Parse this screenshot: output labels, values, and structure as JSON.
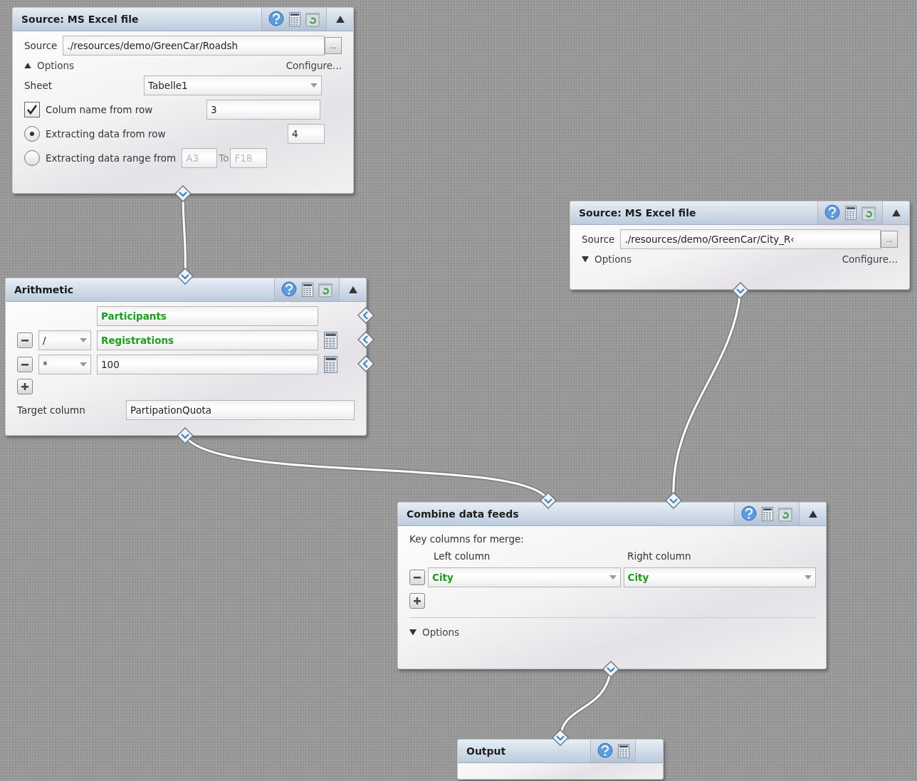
{
  "nodes": [
    {
      "kind": "excel_source",
      "title": "Source: MS Excel file",
      "removable": true,
      "collapsible": true,
      "source": {
        "label": "Source",
        "value": "./resources/demo/GreenCar/Roadsh",
        "browse": "..."
      },
      "options": {
        "label": "Options",
        "expanded": true,
        "configure": "Configure..."
      },
      "sheet": {
        "label": "Sheet",
        "value": "Tabelle1"
      },
      "column_name": {
        "checked": true,
        "label": "Colum name from row",
        "value": "3"
      },
      "extract": [
        {
          "selected": true,
          "label": "Extracting data from row",
          "value": "4"
        },
        {
          "selected": false,
          "label": "Extracting data range from",
          "from": "A3",
          "to_label": "To",
          "to": "F18"
        }
      ]
    },
    {
      "kind": "arithmetic",
      "title": "Arithmetic",
      "removable": true,
      "collapsible": true,
      "operands": [
        {
          "kind": "column",
          "value": "Participants"
        },
        {
          "kind": "column",
          "operator": "/",
          "value": "Registrations"
        },
        {
          "kind": "constant",
          "operator": "*",
          "value": "100"
        }
      ],
      "target": {
        "label": "Target column",
        "value": "PartipationQuota"
      }
    },
    {
      "kind": "excel_source",
      "title": "Source: MS Excel file",
      "removable": true,
      "collapsible": true,
      "source": {
        "label": "Source",
        "value": "./resources/demo/GreenCar/City_R‹",
        "browse": "..."
      },
      "options": {
        "label": "Options",
        "expanded": false,
        "configure": "Configure..."
      }
    },
    {
      "kind": "combine",
      "title": "Combine data feeds",
      "removable": true,
      "collapsible": true,
      "key_label": "Key columns for merge:",
      "left_header": "Left column",
      "right_header": "Right column",
      "keys": [
        {
          "left": "City",
          "right": "City"
        }
      ],
      "options": {
        "label": "Options",
        "expanded": false
      }
    },
    {
      "kind": "output",
      "title": "Output",
      "removable": false,
      "collapsible": false
    }
  ]
}
